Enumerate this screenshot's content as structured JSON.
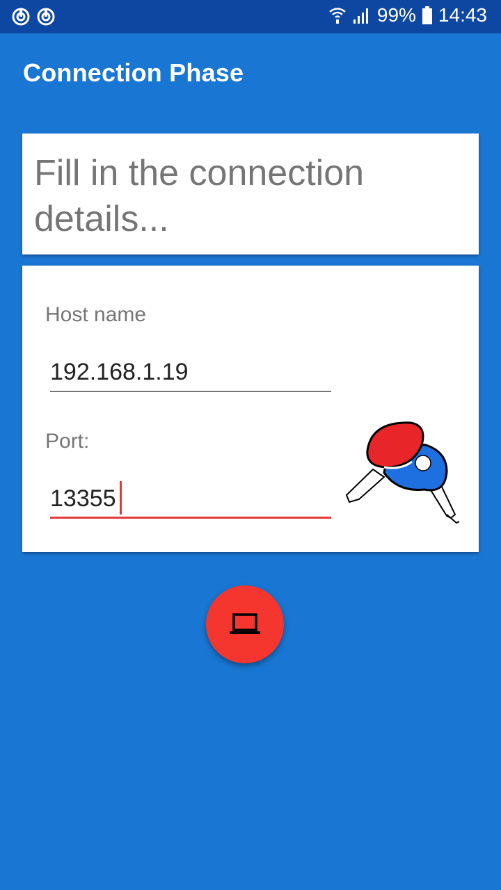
{
  "status_bar": {
    "battery": "99%",
    "time": "14:43",
    "left_icons": [
      "sync-icon",
      "sync-icon"
    ],
    "right_icons": [
      "wifi-icon",
      "signal-icon",
      "battery-icon"
    ]
  },
  "toolbar": {
    "title": "Connection Phase"
  },
  "header_card": {
    "text": "Fill in the connection details..."
  },
  "form": {
    "host_label": "Host name",
    "host_value": "192.168.1.19",
    "port_label": "Port:",
    "port_value": "13355",
    "image_icon": "ping-pong-paddles-icon"
  },
  "fab": {
    "icon": "laptop-icon"
  },
  "colors": {
    "background": "#1976D2",
    "status_bar": "#0D47A1",
    "accent": "#F4362F",
    "focused_underline": "#E53935",
    "label_gray": "#757575"
  }
}
